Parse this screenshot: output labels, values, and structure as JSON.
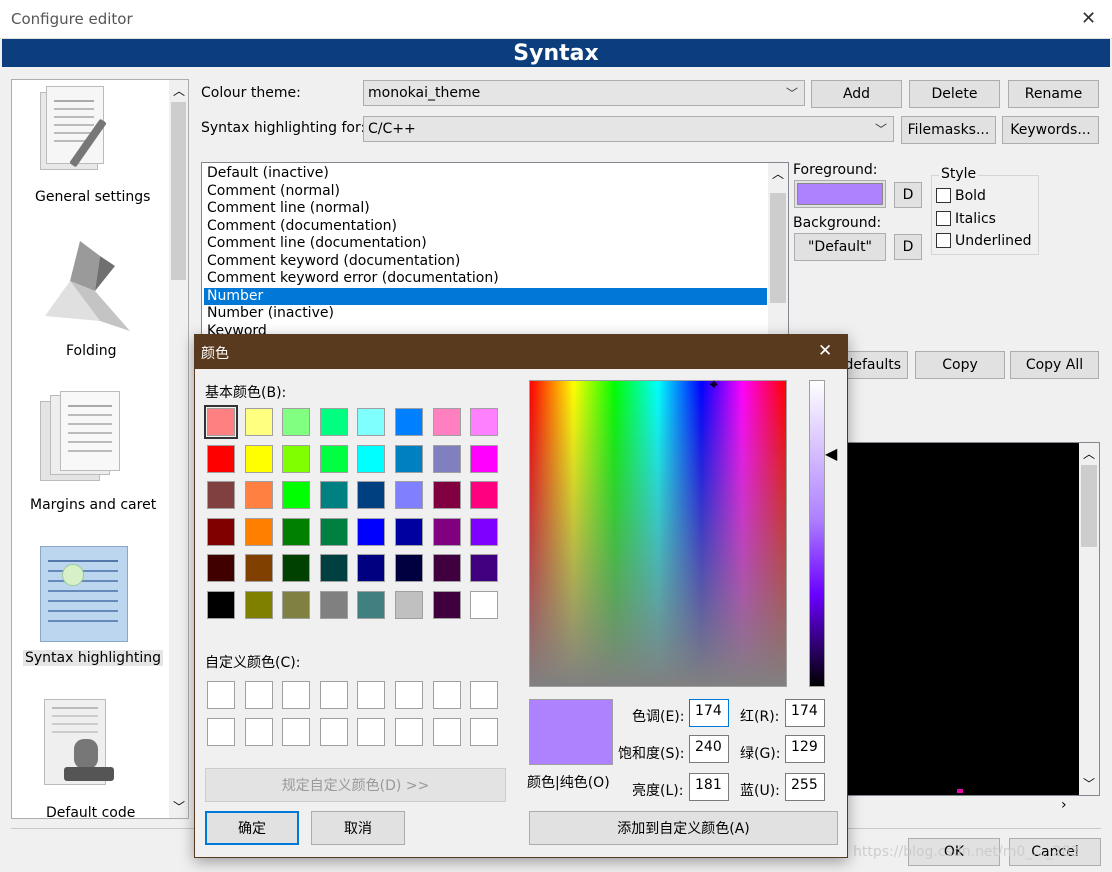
{
  "window": {
    "title": "Configure editor",
    "close_glyph": "✕"
  },
  "banner": {
    "title": "Syntax"
  },
  "sidebar": {
    "items": [
      {
        "label": "General settings",
        "icon": "document-pen-icon"
      },
      {
        "label": "Folding",
        "icon": "origami-icon"
      },
      {
        "label": "Margins and caret",
        "icon": "pages-icon"
      },
      {
        "label": "Syntax highlighting",
        "icon": "highlighted-code-icon"
      },
      {
        "label": "Default code",
        "icon": "stamp-icon"
      }
    ],
    "selected": "Syntax highlighting"
  },
  "theme": {
    "label": "Colour theme:",
    "value": "monokai_theme",
    "add": "Add",
    "delete": "Delete",
    "rename": "Rename"
  },
  "highlight_for": {
    "label": "Syntax highlighting for:",
    "value": "C/C++",
    "filemasks": "Filemasks...",
    "keywords": "Keywords..."
  },
  "styles_list": {
    "items": [
      "Default (inactive)",
      "Comment (normal)",
      "Comment line (normal)",
      "Comment (documentation)",
      "Comment line (documentation)",
      "Comment keyword (documentation)",
      "Comment keyword error (documentation)",
      "Number",
      "Number (inactive)",
      "Keyword"
    ],
    "selected": "Number"
  },
  "colors": {
    "foreground_label": "Foreground:",
    "foreground_color": "#ae81ff",
    "background_label": "Background:",
    "background_value": "\"Default\"",
    "d_button": "D"
  },
  "style_group": {
    "label": "Style",
    "bold": "Bold",
    "italics": "Italics",
    "underlined": "Underlined"
  },
  "mid_buttons": {
    "defaults": "defaults",
    "copy": "Copy",
    "copy_all": "Copy All"
  },
  "footer": {
    "ok": "OK",
    "cancel": "Cancel",
    "watermark": "https://blog.csdn.net/m0_..._283"
  },
  "color_dialog": {
    "title": "颜色",
    "close_glyph": "✕",
    "basic_label": "基本颜色(B):",
    "basic_colors": [
      "#ff8080",
      "#ffff80",
      "#80ff80",
      "#00ff80",
      "#80ffff",
      "#0080ff",
      "#ff80c0",
      "#ff80ff",
      "#ff0000",
      "#ffff00",
      "#80ff00",
      "#00ff40",
      "#00ffff",
      "#0080c0",
      "#8080c0",
      "#ff00ff",
      "#804040",
      "#ff8040",
      "#00ff00",
      "#008080",
      "#004080",
      "#8080ff",
      "#800040",
      "#ff0080",
      "#800000",
      "#ff8000",
      "#008000",
      "#008040",
      "#0000ff",
      "#0000a0",
      "#800080",
      "#8000ff",
      "#400000",
      "#804000",
      "#004000",
      "#004040",
      "#000080",
      "#000040",
      "#400040",
      "#400080",
      "#000000",
      "#808000",
      "#808040",
      "#808080",
      "#408080",
      "#c0c0c0",
      "#400040",
      "#ffffff"
    ],
    "custom_label": "自定义颜色(C):",
    "define_custom": "规定自定义颜色(D) >>",
    "ok": "确定",
    "cancel": "取消",
    "solid_label": "颜色|纯色(O)",
    "hue_label": "色调(E):",
    "hue": "174",
    "sat_label": "饱和度(S):",
    "sat": "240",
    "lum_label": "亮度(L):",
    "lum": "181",
    "red_label": "红(R):",
    "red": "174",
    "green_label": "绿(G):",
    "green": "129",
    "blue_label": "蓝(U):",
    "blue": "255",
    "add_custom": "添加到自定义颜色(A)",
    "preview_color": "#ae81ff"
  }
}
